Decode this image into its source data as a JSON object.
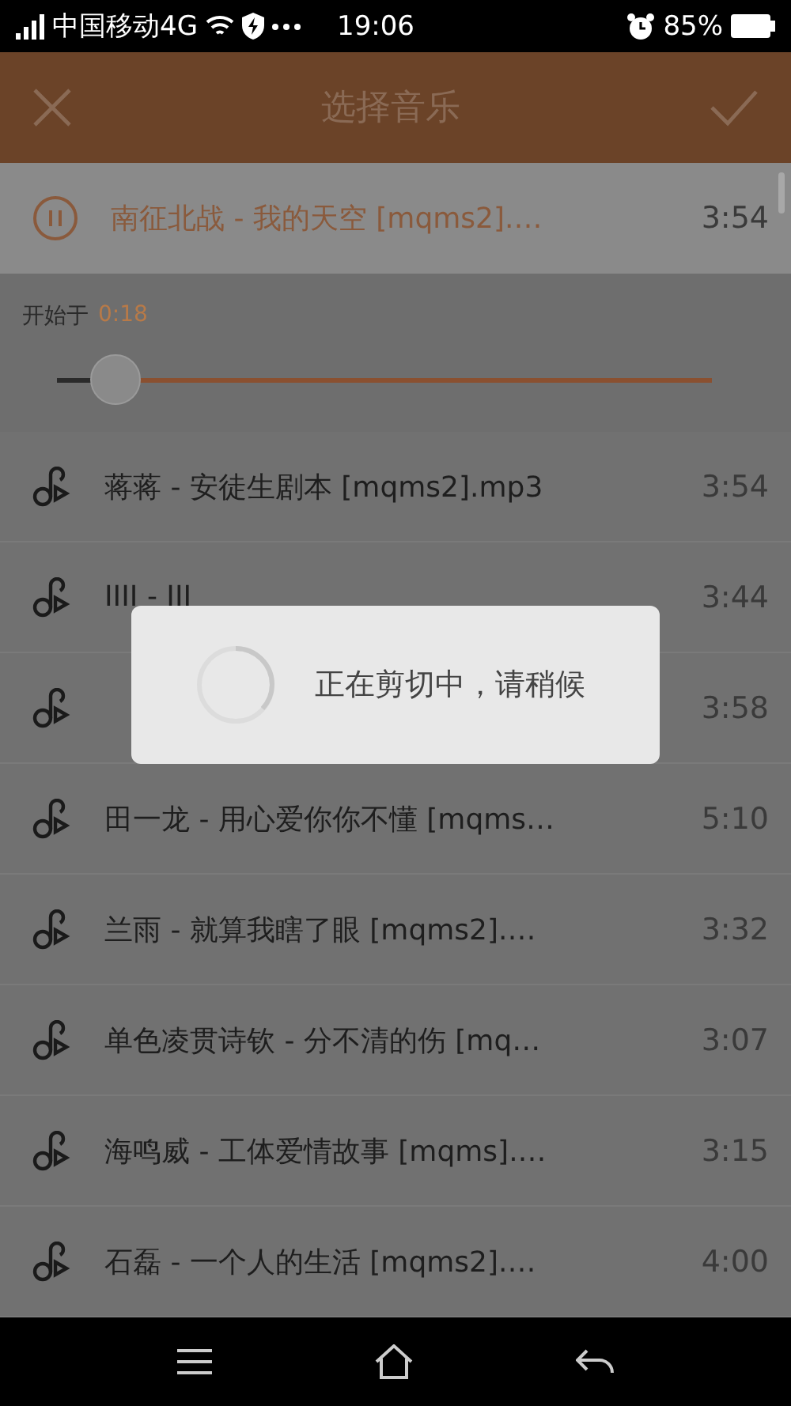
{
  "status_bar": {
    "carrier": "中国移动4G",
    "time": "19:06",
    "battery": "85%"
  },
  "header": {
    "title": "选择音乐"
  },
  "now_playing": {
    "title": "南征北战 - 我的天空 [mqms2].…",
    "duration": "3:54",
    "playing": true
  },
  "start": {
    "label": "开始于",
    "time": "0:18",
    "level": 0.09
  },
  "songs": [
    {
      "title": "蒋蒋 - 安徒生剧本 [mqms2].mp3",
      "duration": "3:54"
    },
    {
      "title": "IIII - III",
      "duration": "3:44"
    },
    {
      "duration": "3:58"
    },
    {
      "title": "田一龙 - 用心爱你你不懂 [mqms…",
      "duration": "5:10"
    },
    {
      "title": "兰雨 - 就算我瞎了眼 [mqms2].…",
      "duration": "3:32"
    },
    {
      "title": "单色凌贯诗钦 - 分不清的伤 [mq…",
      "duration": "3:07"
    },
    {
      "title": "海鸣威 - 工体爱情故事 [mqms].…",
      "duration": "3:15"
    },
    {
      "title": "石磊 - 一个人的生活 [mqms2].…",
      "duration": "4:00"
    }
  ],
  "dialog": {
    "message": "正在剪切中，请稍候"
  }
}
